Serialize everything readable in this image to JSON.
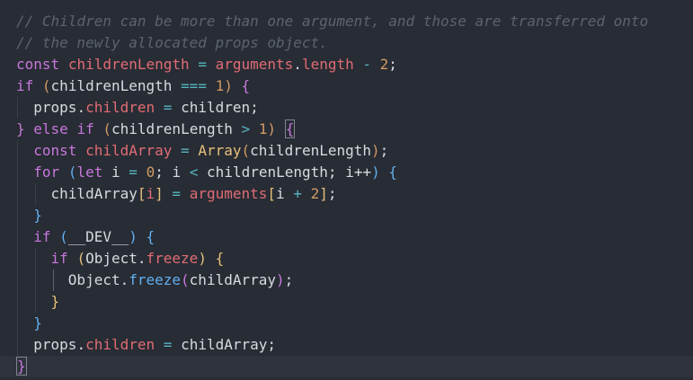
{
  "code": {
    "line1": "// Children can be more than one argument, and those are transferred onto",
    "line2": "// the newly allocated props object.",
    "line3": {
      "kw": "const",
      "name": "childrenLength",
      "eq": "=",
      "obj": "arguments",
      "dot": ".",
      "prop": "length",
      "minus": "-",
      "num": "2",
      "semi": ";"
    },
    "line4": {
      "kw": "if",
      "open": "(",
      "name": "childrenLength",
      "op": "===",
      "num": "1",
      "close": ")",
      "brace": "{"
    },
    "line5": {
      "obj": "props",
      "dot": ".",
      "prop": "children",
      "eq": "=",
      "val": "children",
      "semi": ";"
    },
    "line6": {
      "brace": "}",
      "kw1": "else",
      "kw2": "if",
      "open": "(",
      "name": "childrenLength",
      "op": ">",
      "num": "1",
      "close": ")",
      "brace2": "{"
    },
    "line7": {
      "kw": "const",
      "name": "childArray",
      "eq": "=",
      "fn": "Array",
      "open": "(",
      "arg": "childrenLength",
      "close": ")",
      "semi": ";"
    },
    "line8": {
      "kw": "for",
      "open": "(",
      "let": "let",
      "i": "i",
      "eq": "=",
      "zero": "0",
      "s1": ";",
      "i2": "i",
      "lt": "<",
      "name": "childrenLength",
      "s2": ";",
      "inc": "i++",
      "close": ")",
      "brace": "{"
    },
    "line9": {
      "name": "childArray",
      "lb": "[",
      "i": "i",
      "rb": "]",
      "eq": "=",
      "args": "arguments",
      "lb2": "[",
      "i2": "i",
      "plus": "+",
      "num": "2",
      "rb2": "]",
      "semi": ";"
    },
    "line10": "}",
    "line11": {
      "kw": "if",
      "open": "(",
      "dev": "__DEV__",
      "close": ")",
      "brace": "{"
    },
    "line12": {
      "kw": "if",
      "open": "(",
      "obj": "Object",
      "dot": ".",
      "prop": "freeze",
      "close": ")",
      "brace": "{"
    },
    "line13": {
      "obj": "Object",
      "dot": ".",
      "fn": "freeze",
      "open": "(",
      "arg": "childArray",
      "close": ")",
      "semi": ";"
    },
    "line14": "}",
    "line15": "}",
    "line16": {
      "obj": "props",
      "dot": ".",
      "prop": "children",
      "eq": "=",
      "val": "childArray",
      "semi": ";"
    },
    "line17": "}"
  },
  "colors": {
    "background": "#282c34",
    "comment": "#5c6370",
    "keyword": "#c678dd",
    "variable": "#e06c75",
    "function": "#61afef",
    "number": "#d19a66",
    "operator": "#56b6c2"
  }
}
